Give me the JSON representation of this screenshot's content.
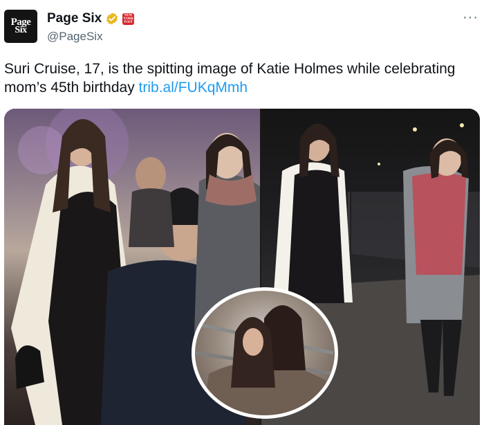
{
  "account": {
    "avatar_line1": "Page",
    "avatar_line2": "Six",
    "display_name": "Page Six",
    "handle": "@PageSix",
    "affiliate_badge_text": "NEW YORK POST"
  },
  "icons": {
    "verified": "verified-badge-icon",
    "affiliate": "affiliate-badge-icon",
    "more": "more-options-icon"
  },
  "tweet": {
    "text": "Suri Cruise, 17, is the spitting image of Katie Holmes while celebrating mom’s 45th birthday ",
    "link": "trib.al/FUKqMmh"
  },
  "more_label": "···",
  "colors": {
    "link": "#1d9bf0",
    "verified": "#e8b923",
    "affiliate": "#d8232a",
    "secondary_text": "#536471"
  }
}
